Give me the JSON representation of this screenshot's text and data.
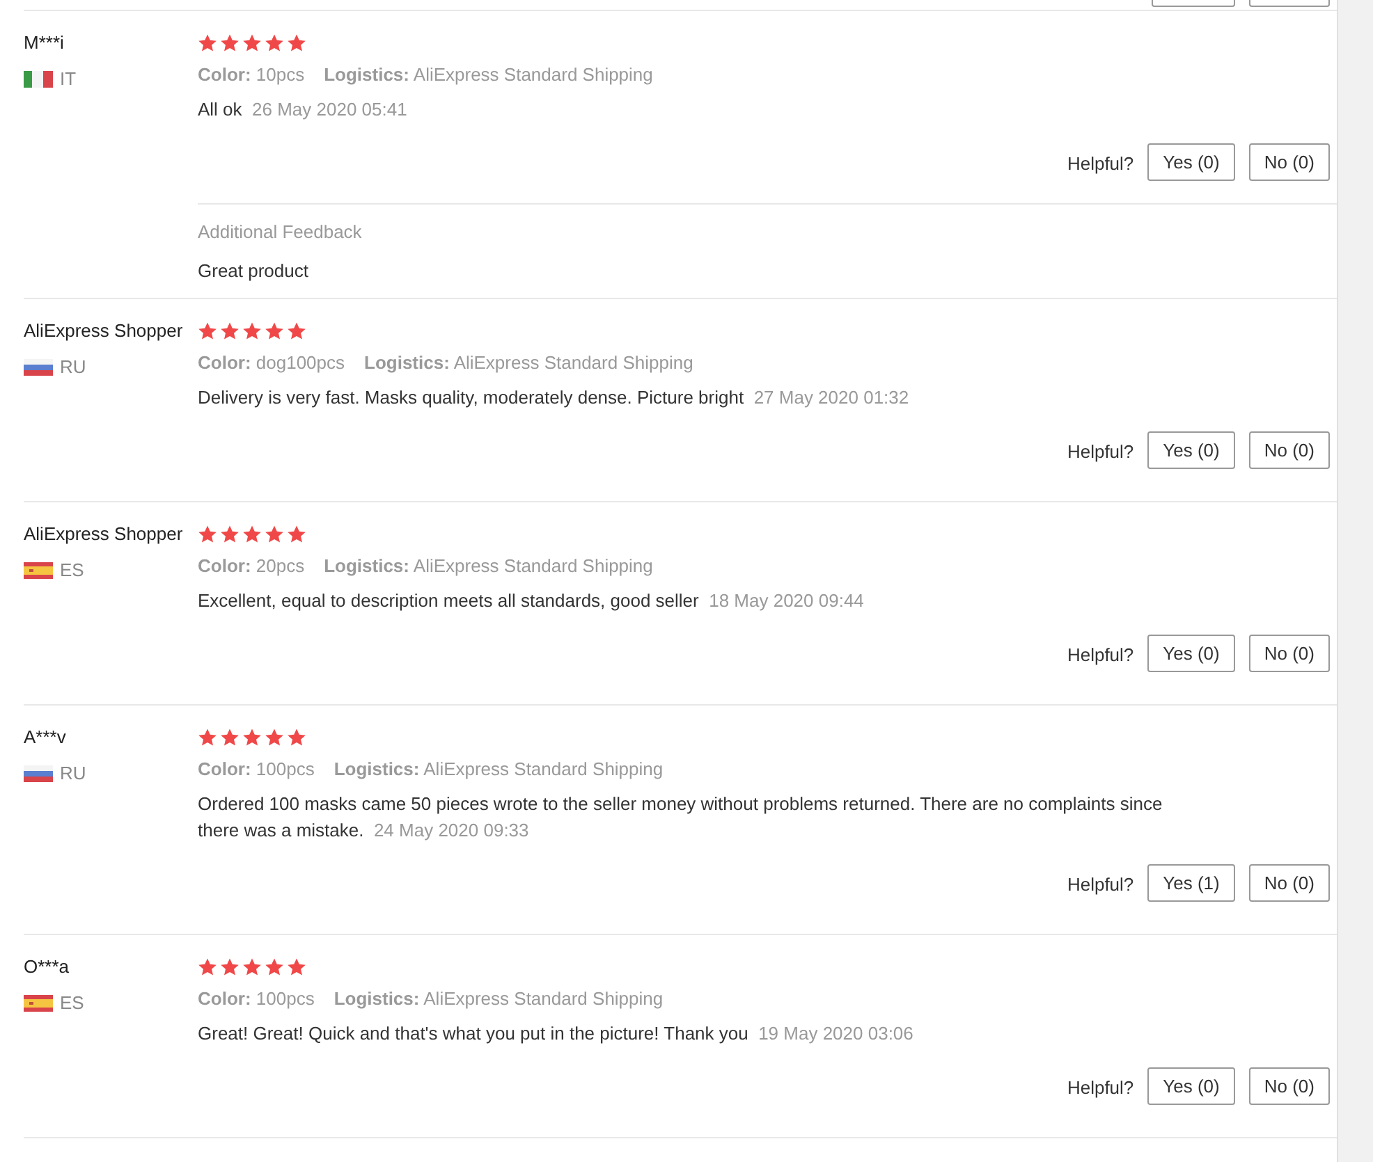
{
  "reviews": [
    {
      "name": "M***i",
      "kind": "it",
      "country": "IT",
      "stars": 5,
      "color_label": "Color:",
      "variant": "10pcs",
      "logistics_label": "Logistics:",
      "logistics": "AliExpress Standard Shipping",
      "text": "All ok",
      "date": "26 May 2020 05:41",
      "helpful_label": "Helpful?",
      "yes": "Yes (0)",
      "no": "No (0)",
      "additional_feedback": {
        "label": "Additional Feedback",
        "text": "Great product"
      }
    },
    {
      "name": "AliExpress Shopper",
      "kind": "ru",
      "country": "RU",
      "stars": 5,
      "color_label": "Color:",
      "variant": "dog100pcs",
      "logistics_label": "Logistics:",
      "logistics": "AliExpress Standard Shipping",
      "text": "Delivery is very fast. Masks quality, moderately dense. Picture bright",
      "date": "27 May 2020 01:32",
      "helpful_label": "Helpful?",
      "yes": "Yes (0)",
      "no": "No (0)"
    },
    {
      "name": "AliExpress Shopper",
      "kind": "es",
      "country": "ES",
      "stars": 5,
      "color_label": "Color:",
      "variant": "20pcs",
      "logistics_label": "Logistics:",
      "logistics": "AliExpress Standard Shipping",
      "text": "Excellent, equal to description meets all standards, good seller",
      "date": "18 May 2020 09:44",
      "helpful_label": "Helpful?",
      "yes": "Yes (0)",
      "no": "No (0)"
    },
    {
      "name": "A***v",
      "kind": "ru",
      "country": "RU",
      "stars": 5,
      "color_label": "Color:",
      "variant": "100pcs",
      "logistics_label": "Logistics:",
      "logistics": "AliExpress Standard Shipping",
      "text": "Ordered 100 masks came 50 pieces wrote to the seller money without problems returned. There are no complaints since there was a mistake.",
      "date": "24 May 2020 09:33",
      "helpful_label": "Helpful?",
      "yes": "Yes (1)",
      "no": "No (0)"
    },
    {
      "name": "O***a",
      "kind": "es",
      "country": "ES",
      "stars": 5,
      "color_label": "Color:",
      "variant": "100pcs",
      "logistics_label": "Logistics:",
      "logistics": "AliExpress Standard Shipping",
      "text": "Great! Great! Quick and that's what you put in the picture! Thank you",
      "date": "19 May 2020 03:06",
      "helpful_label": "Helpful?",
      "yes": "Yes (0)",
      "no": "No (0)"
    }
  ]
}
